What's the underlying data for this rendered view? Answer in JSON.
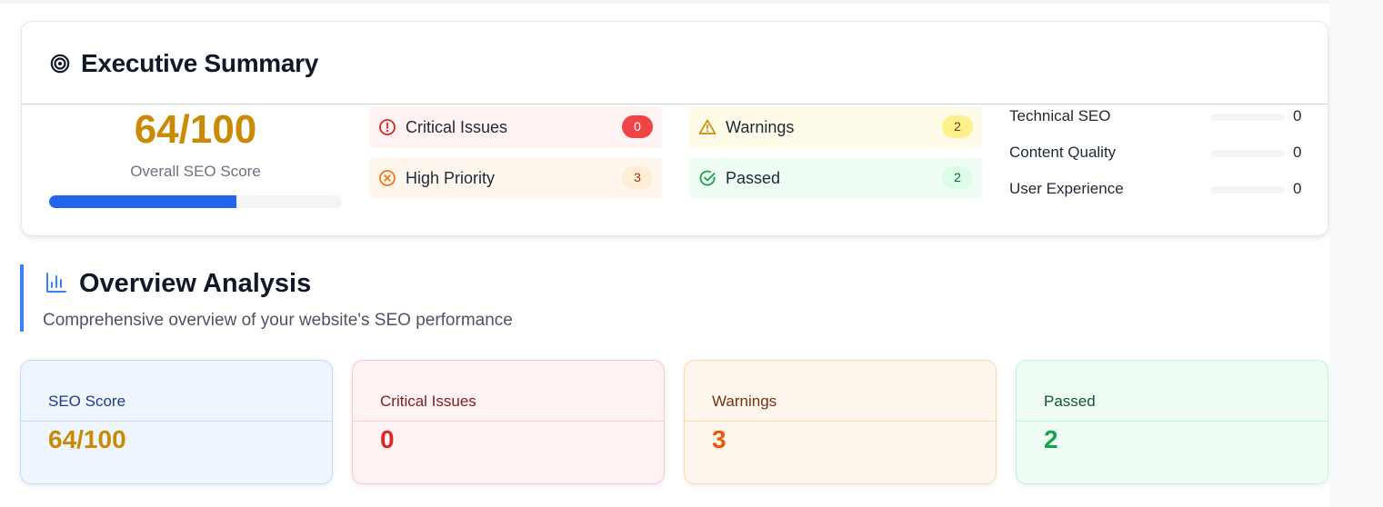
{
  "executive_summary": {
    "title": "Executive Summary",
    "icon": "target-icon",
    "score": {
      "value_text": "64/100",
      "label": "Overall SEO Score",
      "progress": 0.64,
      "color": "#ca8a04",
      "bar_color": "#2563eb"
    },
    "issues": {
      "critical": {
        "label": "Critical Issues",
        "count": "0",
        "icon": "alert-circle-icon"
      },
      "high": {
        "label": "High Priority",
        "count": "3",
        "icon": "x-circle-icon"
      },
      "warnings": {
        "label": "Warnings",
        "count": "2",
        "icon": "warning-triangle-icon"
      },
      "passed": {
        "label": "Passed",
        "count": "2",
        "icon": "check-circle-icon"
      }
    },
    "metrics": [
      {
        "label": "Technical SEO",
        "value": "0",
        "progress": 0
      },
      {
        "label": "Content Quality",
        "value": "0",
        "progress": 0
      },
      {
        "label": "User Experience",
        "value": "0",
        "progress": 0
      }
    ]
  },
  "overview": {
    "title": "Overview Analysis",
    "icon": "bar-chart-icon",
    "subtitle": "Comprehensive overview of your website's SEO performance",
    "cards": [
      {
        "label": "SEO Score",
        "value": "64/100"
      },
      {
        "label": "Critical Issues",
        "value": "0"
      },
      {
        "label": "Warnings",
        "value": "3"
      },
      {
        "label": "Passed",
        "value": "2"
      }
    ]
  },
  "colors": {
    "accent": "#3b82f6",
    "critical": "#ef4444",
    "high": "#f97316",
    "warning": "#eab308",
    "passed": "#22c55e"
  }
}
